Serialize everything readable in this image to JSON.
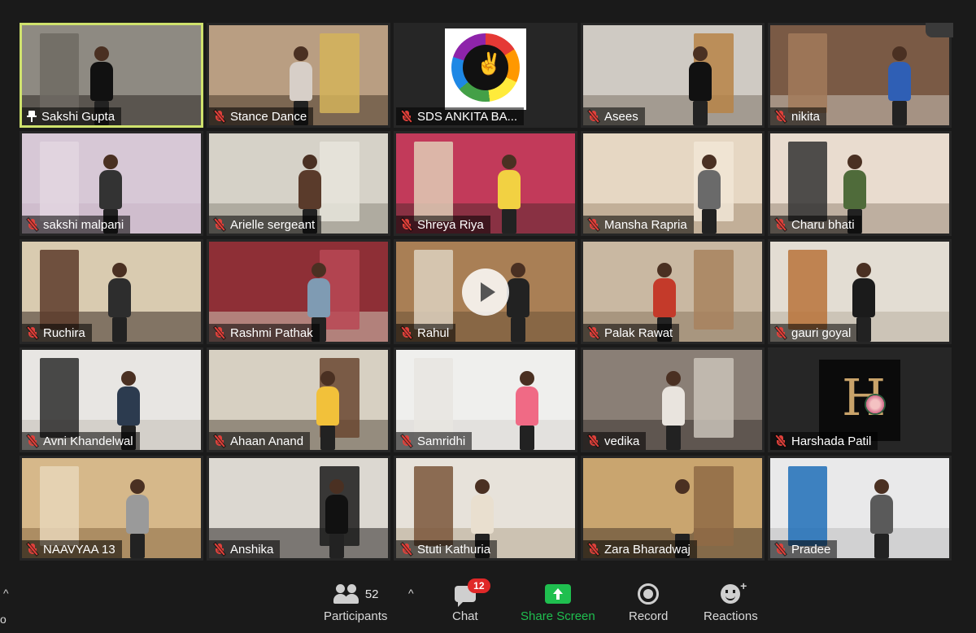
{
  "participants": [
    {
      "name": "Sakshi Gupta",
      "pinned": true,
      "active": true,
      "muted": false,
      "wall": "#8e8a82",
      "floor": "#2f2a26",
      "door": "#6f6a63",
      "shirt": "#111111"
    },
    {
      "name": "Stance Dance",
      "muted": true,
      "wall": "#b99e82",
      "floor": "#4b3a2c",
      "door": "#d4b35a",
      "shirt": "#d7cfc8"
    },
    {
      "name": "SDS ANKITA BA...",
      "muted": true,
      "logo": "peace",
      "wall": "#1e1e1e",
      "floor": "#1e1e1e",
      "door": "#1e1e1e",
      "shirt": "#1e1e1e"
    },
    {
      "name": "Asees",
      "muted": true,
      "wall": "#cfcac3",
      "floor": "#7f7468",
      "door": "#b78446",
      "shirt": "#111111"
    },
    {
      "name": "nikita",
      "muted": true,
      "wall": "#7a5a45",
      "floor": "#c9c1b6",
      "door": "#a27a5b",
      "shirt": "#2f5fb5"
    },
    {
      "name": "sakshi malpani",
      "muted": true,
      "wall": "#d7c8d6",
      "floor": "#c8b5c6",
      "door": "#e3d6e1",
      "shirt": "#333333"
    },
    {
      "name": "Arielle sergeant",
      "muted": true,
      "wall": "#d6d2c8",
      "floor": "#8f8a80",
      "door": "#e8e5dc",
      "shirt": "#5a3b2b"
    },
    {
      "name": "Shreya Riya",
      "muted": true,
      "wall": "#c23a5a",
      "floor": "#5b2a31",
      "door": "#e1cdb6",
      "shirt": "#f2d142"
    },
    {
      "name": "Mansha Rapria",
      "muted": true,
      "wall": "#e6d7c3",
      "floor": "#a48e75",
      "door": "#f1e6d6",
      "shirt": "#6a6a6a"
    },
    {
      "name": "Charu bhati",
      "muted": true,
      "wall": "#e9dccf",
      "floor": "#9b8a7a",
      "door": "#333333",
      "shirt": "#4f6b3a"
    },
    {
      "name": "Ruchira",
      "muted": true,
      "wall": "#d9cbb0",
      "floor": "#3b2e26",
      "door": "#5c3b2a",
      "shirt": "#2d2d2d"
    },
    {
      "name": "Rashmi Pathak",
      "muted": true,
      "wall": "#8e2f36",
      "floor": "#cfc4b5",
      "door": "#b84855",
      "shirt": "#7f9bb3"
    },
    {
      "name": "Rahul",
      "muted": true,
      "play": true,
      "wall": "#a97f55",
      "floor": "#6e5438",
      "door": "#ddd1c0",
      "shirt": "#222222"
    },
    {
      "name": "Palak Rawat",
      "muted": true,
      "wall": "#c9b8a2",
      "floor": "#8d7a63",
      "door": "#a8835e",
      "shirt": "#c43a2a"
    },
    {
      "name": "gauri goyal",
      "muted": true,
      "wall": "#e3ddd3",
      "floor": "#b9afa1",
      "door": "#b8733a",
      "shirt": "#1b1b1b"
    },
    {
      "name": "Avni Khandelwal",
      "muted": true,
      "wall": "#e8e6e3",
      "floor": "#c2beb7",
      "door": "#2b2b2b",
      "shirt": "#2c3b4f"
    },
    {
      "name": "Ahaan Anand",
      "muted": true,
      "wall": "#d7d0c2",
      "floor": "#5f5447",
      "door": "#6a4630",
      "shirt": "#f2c13a"
    },
    {
      "name": "Samridhi",
      "muted": true,
      "wall": "#efefed",
      "floor": "#d8d6d1",
      "door": "#e7e5e1",
      "shirt": "#f06a85"
    },
    {
      "name": "vedika",
      "muted": true,
      "wall": "#8a7f76",
      "floor": "#3c3531",
      "door": "#c9c2b8",
      "shirt": "#e9e4de"
    },
    {
      "name": "Harshada Patil",
      "muted": true,
      "logo": "letter-h",
      "logo_text": "H",
      "wall": "#1e1e1e",
      "floor": "#1e1e1e",
      "door": "#1e1e1e",
      "shirt": "#1e1e1e"
    },
    {
      "name": "NAAVYAA 13",
      "muted": true,
      "wall": "#d6b88a",
      "floor": "#8a6a44",
      "door": "#e7d6b8",
      "shirt": "#9a9a9a"
    },
    {
      "name": "Anshika",
      "muted": true,
      "wall": "#dcd8d1",
      "floor": "#2b2826",
      "door": "#1b1b1b",
      "shirt": "#111111"
    },
    {
      "name": "Stuti Kathuria",
      "muted": true,
      "wall": "#e7e2da",
      "floor": "#b7a892",
      "door": "#7a5639",
      "shirt": "#e9dfcf"
    },
    {
      "name": "Zara Bharadwaj",
      "muted": true,
      "wall": "#c9a56f",
      "floor": "#4a3a2a",
      "door": "#8f6a45",
      "shirt": "#c9a56f"
    },
    {
      "name": "Pradee",
      "muted": true,
      "wall": "#e9e9ea",
      "floor": "#bdbdbd",
      "door": "#1f6fb8",
      "shirt": "#5a5a5a"
    }
  ],
  "toolbar": {
    "participants_label": "Participants",
    "participants_count": "52",
    "chat_label": "Chat",
    "chat_badge": "12",
    "share_label": "Share Screen",
    "record_label": "Record",
    "reactions_label": "Reactions",
    "left_fragment": "o",
    "caret": "^",
    "reactions_plus": "+"
  },
  "colors": {
    "active_speaker_border": "#cfe26d",
    "muted_red": "#e0413b",
    "share_green": "#1fbf4f",
    "badge_red": "#e02828"
  }
}
